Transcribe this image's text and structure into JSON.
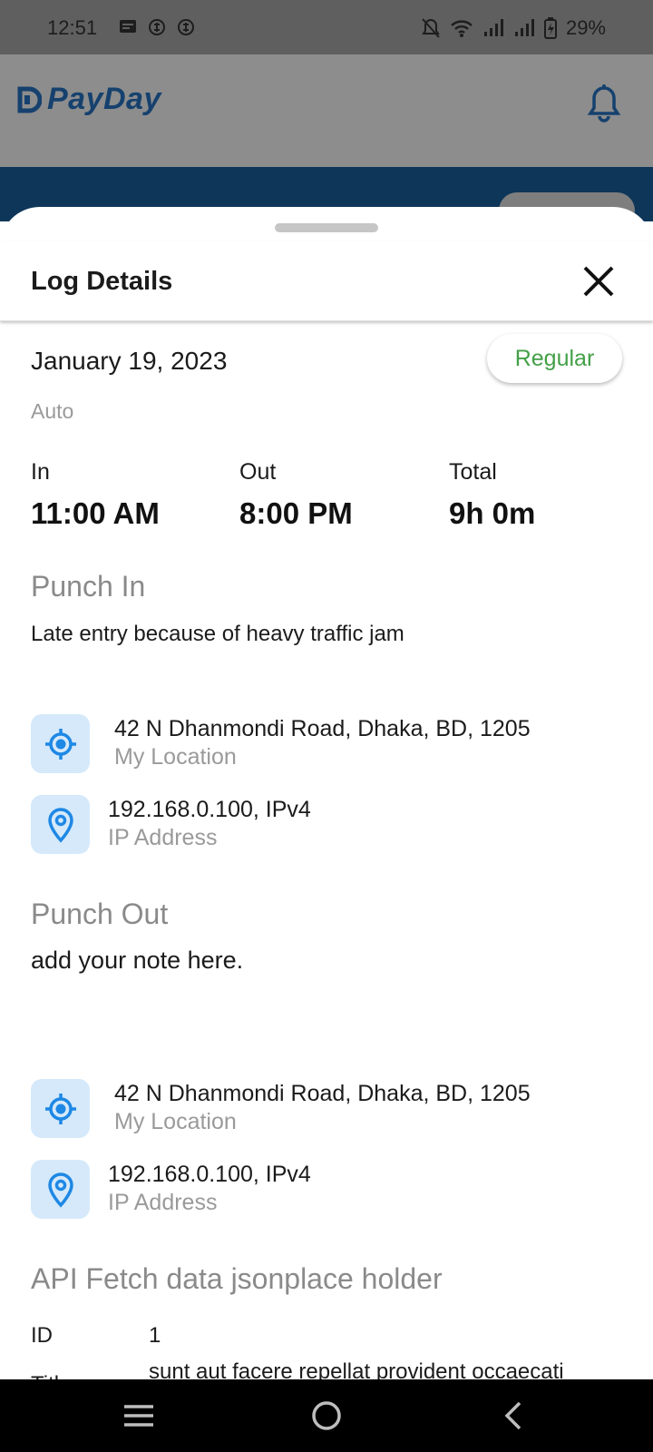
{
  "status_bar": {
    "time": "12:51",
    "battery": "29%",
    "icons": [
      "message-icon",
      "sim-icon",
      "sim-icon",
      "mute-icon",
      "wifi-icon",
      "signal-icon",
      "signal-icon",
      "battery-icon"
    ]
  },
  "app": {
    "brand": "PayDay",
    "brand_color": "#16416e"
  },
  "sheet": {
    "title": "Log Details",
    "date": "January 19, 2023",
    "badge": "Regular",
    "badge_color": "#43a047",
    "source": "Auto",
    "times": [
      {
        "label": "In",
        "value": "11:00 AM"
      },
      {
        "label": "Out",
        "value": "8:00 PM"
      },
      {
        "label": "Total",
        "value": "9h 0m"
      }
    ],
    "punch_in": {
      "title": "Punch In",
      "note": "Late entry because of heavy traffic jam",
      "location": {
        "value": "42 N Dhanmondi Road, Dhaka, BD, 1205",
        "label": "My Location"
      },
      "ip": {
        "value": "192.168.0.100, IPv4",
        "label": "IP Address"
      }
    },
    "punch_out": {
      "title": "Punch Out",
      "note": "add your note here.",
      "location": {
        "value": "42 N Dhanmondi Road, Dhaka, BD, 1205",
        "label": "My Location"
      },
      "ip": {
        "value": "192.168.0.100, IPv4",
        "label": "IP Address"
      }
    },
    "api": {
      "title": "API Fetch data jsonplace holder",
      "id_key": "ID",
      "id_value": "1",
      "title_key": "Title",
      "title_value": "sunt aut facere repellat provident occaecati"
    }
  }
}
